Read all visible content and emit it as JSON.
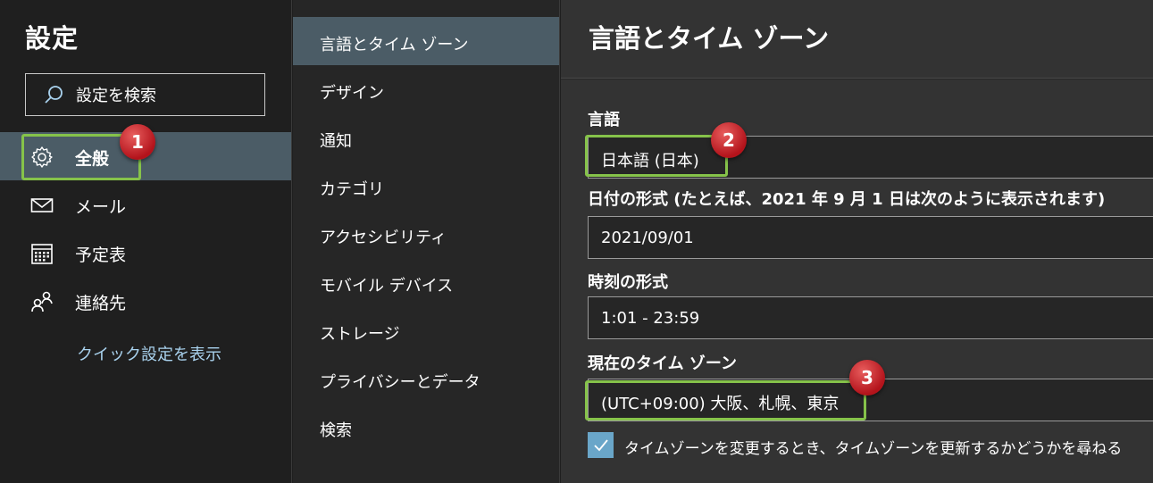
{
  "settings": {
    "title": "設定",
    "search_placeholder": "設定を検索",
    "nav": [
      {
        "label": "全般",
        "icon": "gear-icon",
        "selected": true
      },
      {
        "label": "メール",
        "icon": "mail-icon"
      },
      {
        "label": "予定表",
        "icon": "calendar-icon"
      },
      {
        "label": "連絡先",
        "icon": "people-icon"
      }
    ],
    "quick_settings_link": "クイック設定を表示"
  },
  "subnav": [
    {
      "label": "言語とタイム ゾーン",
      "selected": true
    },
    {
      "label": "デザイン"
    },
    {
      "label": "通知"
    },
    {
      "label": "カテゴリ"
    },
    {
      "label": "アクセシビリティ"
    },
    {
      "label": "モバイル デバイス"
    },
    {
      "label": "ストレージ"
    },
    {
      "label": "プライバシーとデータ"
    },
    {
      "label": "検索"
    }
  ],
  "panel": {
    "title": "言語とタイム ゾーン",
    "language_label": "言語",
    "language_value": "日本語 (日本)",
    "date_format_label": "日付の形式 (たとえば、2021 年 9 月 1 日は次のように表示されます)",
    "date_format_value": "2021/09/01",
    "time_format_label": "時刻の形式",
    "time_format_value": "1:01 - 23:59",
    "timezone_label": "現在のタイム ゾーン",
    "timezone_value": "(UTC+09:00) 大阪、札幌、東京",
    "update_timezone_checkbox": "タイムゾーンを変更するとき、タイムゾーンを更新するかどうかを尋ねる",
    "update_timezone_checked": true
  },
  "annotations": [
    "1",
    "2",
    "3"
  ],
  "colors": {
    "selected_bg": "#4b5c66",
    "highlight": "#86c34a",
    "badge": "#c8161e",
    "link": "#a9d2ee"
  }
}
